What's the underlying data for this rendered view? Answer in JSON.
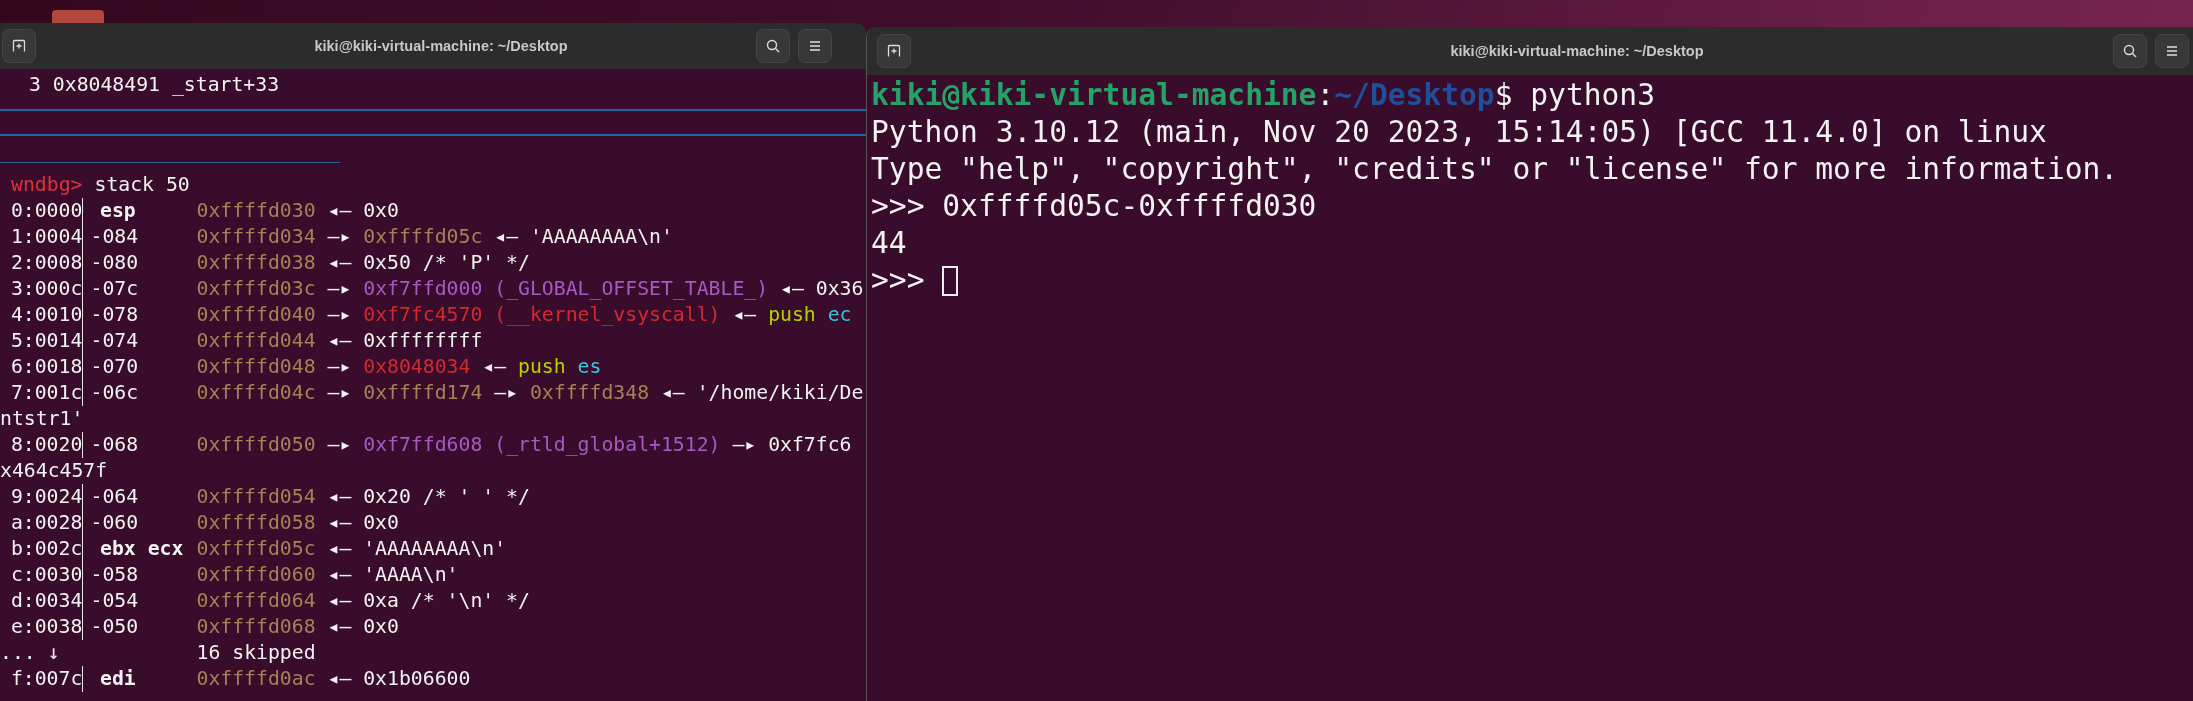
{
  "left_terminal": {
    "title": "kiki@kiki-virtual-machine: ~/Desktop",
    "backtrace": "3 0x8048491 _start+33",
    "prompt": {
      "prompt": "wndbg>",
      "command": "stack 50"
    },
    "rows": [
      {
        "kind": "reg",
        "index": "0:0000",
        "label": "esp",
        "address": "0xffffd030",
        "value": [
          {
            "kind": "plain",
            "text": "◂— 0x0"
          }
        ]
      },
      {
        "kind": "offset",
        "index": "1:0004",
        "label": "-084",
        "address": "0xffffd034",
        "value": [
          {
            "kind": "plain",
            "text": "—▸ "
          },
          {
            "kind": "addr",
            "text": "0xffffd05c"
          },
          {
            "kind": "plain",
            "text": " ◂— 'AAAAAAAA\\n'"
          }
        ]
      },
      {
        "kind": "offset",
        "index": "2:0008",
        "label": "-080",
        "address": "0xffffd038",
        "value": [
          {
            "kind": "plain",
            "text": "◂— 0x50 /* 'P' */"
          }
        ]
      },
      {
        "kind": "offset",
        "index": "3:000c",
        "label": "-07c",
        "address": "0xffffd03c",
        "value": [
          {
            "kind": "plain",
            "text": "—▸ "
          },
          {
            "kind": "data",
            "text": "0xf7ffd000 (_GLOBAL_OFFSET_TABLE_)"
          },
          {
            "kind": "plain",
            "text": " ◂— 0x36"
          }
        ]
      },
      {
        "kind": "offset",
        "index": "4:0010",
        "label": "-078",
        "address": "0xffffd040",
        "value": [
          {
            "kind": "plain",
            "text": "—▸ "
          },
          {
            "kind": "code",
            "text": "0xf7fc4570 (__kernel_vsyscall)"
          },
          {
            "kind": "plain",
            "text": " ◂— "
          },
          {
            "kind": "asm",
            "text": "push"
          },
          {
            "kind": "operand",
            "text": "ec"
          }
        ]
      },
      {
        "kind": "offset",
        "index": "5:0014",
        "label": "-074",
        "address": "0xffffd044",
        "value": [
          {
            "kind": "plain",
            "text": "◂— 0xffffffff"
          }
        ]
      },
      {
        "kind": "offset",
        "index": "6:0018",
        "label": "-070",
        "address": "0xffffd048",
        "value": [
          {
            "kind": "plain",
            "text": "—▸ "
          },
          {
            "kind": "code",
            "text": "0x8048034"
          },
          {
            "kind": "plain",
            "text": " ◂— "
          },
          {
            "kind": "asm",
            "text": "push"
          },
          {
            "kind": "operand",
            "text": "es"
          }
        ]
      },
      {
        "kind": "offset",
        "index": "7:001c",
        "label": "-06c",
        "address": "0xffffd04c",
        "value": [
          {
            "kind": "plain",
            "text": "—▸ "
          },
          {
            "kind": "addr",
            "text": "0xffffd174"
          },
          {
            "kind": "plain",
            "text": " —▸ "
          },
          {
            "kind": "addr",
            "text": "0xffffd348"
          },
          {
            "kind": "plain",
            "text": " ◂— '/home/kiki/De"
          }
        ]
      },
      {
        "kind": "wrap",
        "text": "ntstr1'"
      },
      {
        "kind": "offset",
        "index": "8:0020",
        "label": "-068",
        "address": "0xffffd050",
        "value": [
          {
            "kind": "plain",
            "text": "—▸ "
          },
          {
            "kind": "data",
            "text": "0xf7ffd608 (_rtld_global+1512)"
          },
          {
            "kind": "plain",
            "text": " —▸ 0xf7fc6"
          }
        ]
      },
      {
        "kind": "wrap",
        "text": "x464c457f"
      },
      {
        "kind": "offset",
        "index": "9:0024",
        "label": "-064",
        "address": "0xffffd054",
        "value": [
          {
            "kind": "plain",
            "text": "◂— 0x20 /* ' ' */"
          }
        ]
      },
      {
        "kind": "offset",
        "index": "a:0028",
        "label": "-060",
        "address": "0xffffd058",
        "value": [
          {
            "kind": "plain",
            "text": "◂— 0x0"
          }
        ]
      },
      {
        "kind": "reg",
        "index": "b:002c",
        "label": "ebx ecx",
        "address": "0xffffd05c",
        "value": [
          {
            "kind": "plain",
            "text": "◂— 'AAAAAAAA\\n'"
          }
        ]
      },
      {
        "kind": "offset",
        "index": "c:0030",
        "label": "-058",
        "address": "0xffffd060",
        "value": [
          {
            "kind": "plain",
            "text": "◂— 'AAAA\\n'"
          }
        ]
      },
      {
        "kind": "offset",
        "index": "d:0034",
        "label": "-054",
        "address": "0xffffd064",
        "value": [
          {
            "kind": "plain",
            "text": "◂— 0xa /* '\\n' */"
          }
        ]
      },
      {
        "kind": "offset",
        "index": "e:0038",
        "label": "-050",
        "address": "0xffffd068",
        "value": [
          {
            "kind": "plain",
            "text": "◂— 0x0"
          }
        ]
      },
      {
        "kind": "skip",
        "index": "... ↓",
        "text": "16 skipped"
      },
      {
        "kind": "reg",
        "index": "f:007c",
        "label": "edi",
        "address": "0xffffd0ac",
        "value": [
          {
            "kind": "plain",
            "text": "◂— 0x1b06600"
          }
        ]
      }
    ]
  },
  "right_terminal": {
    "title": "kiki@kiki-virtual-machine: ~/Desktop",
    "lines": [
      [
        {
          "kind": "user",
          "text": "kiki@kiki-virtual-machine"
        },
        {
          "kind": "plain",
          "text": ":"
        },
        {
          "kind": "path",
          "text": "~/Desktop"
        },
        {
          "kind": "plain",
          "text": "$ python3"
        }
      ],
      [
        {
          "kind": "plain",
          "text": "Python 3.10.12 (main, Nov 20 2023, 15:14:05) [GCC 11.4.0] on linux"
        }
      ],
      [
        {
          "kind": "plain",
          "text": "Type \"help\", \"copyright\", \"credits\" or \"license\" for more information."
        }
      ],
      [
        {
          "kind": "plain",
          "text": ">>> 0xffffd05c-0xffffd030"
        }
      ],
      [
        {
          "kind": "plain",
          "text": "44"
        }
      ],
      [
        {
          "kind": "plain",
          "text": ">>> "
        }
      ]
    ],
    "cursor_visible": true
  }
}
